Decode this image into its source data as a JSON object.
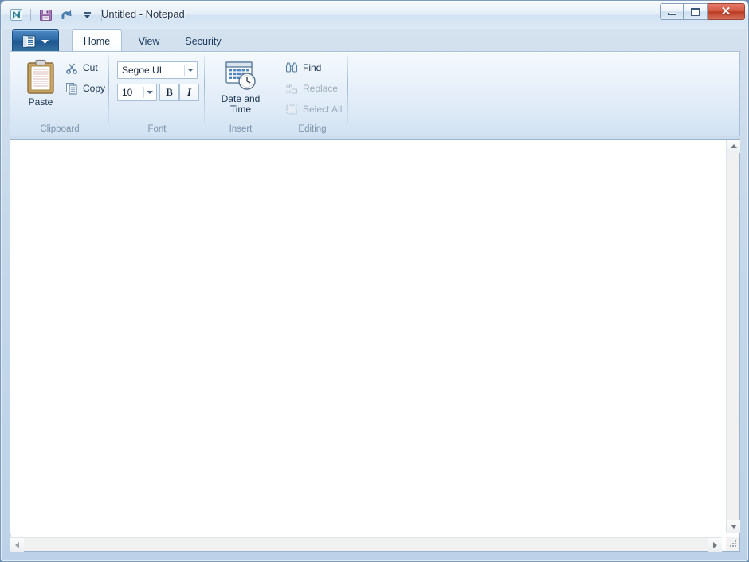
{
  "window": {
    "title": "Untitled - Notepad",
    "app_icon": "notepad-app-icon"
  },
  "quick_access_toolbar": {
    "items": [
      {
        "name": "save-button",
        "icon": "floppy-disk-icon",
        "label": "Save"
      },
      {
        "name": "undo-button",
        "icon": "undo-arrow-icon",
        "label": "Undo"
      },
      {
        "name": "customize-qat-button",
        "icon": "chevron-down-icon",
        "label": "Customize Quick Access Toolbar"
      }
    ]
  },
  "window_controls": {
    "minimize": "Minimize",
    "maximize": "Maximize",
    "close": "Close",
    "close_color": "#c0392b"
  },
  "ribbon": {
    "app_menu_label": "File",
    "tabs": [
      {
        "label": "Home",
        "active": true
      },
      {
        "label": "View",
        "active": false
      },
      {
        "label": "Security",
        "active": false
      }
    ],
    "groups": [
      {
        "label": "Clipboard",
        "big_buttons": [
          {
            "label": "Paste",
            "icon": "clipboard-icon",
            "enabled": true
          }
        ],
        "small_buttons": [
          {
            "label": "Cut",
            "icon": "scissors-icon",
            "enabled": true
          },
          {
            "label": "Copy",
            "icon": "copy-pages-icon",
            "enabled": true
          }
        ]
      },
      {
        "label": "Font",
        "font_family_value": "Segoe UI",
        "font_size_value": "10",
        "bold_label": "B",
        "italic_label": "I"
      },
      {
        "label": "Insert",
        "big_buttons": [
          {
            "label": "Date and Time",
            "line1": "Date and",
            "line2": "Time",
            "icon": "calendar-clock-icon",
            "enabled": true
          }
        ]
      },
      {
        "label": "Editing",
        "small_buttons": [
          {
            "label": "Find",
            "icon": "binoculars-icon",
            "enabled": true
          },
          {
            "label": "Replace",
            "icon": "replace-abac-icon",
            "enabled": false
          },
          {
            "label": "Select All",
            "icon": "select-all-dashed-box-icon",
            "enabled": false
          }
        ]
      }
    ]
  },
  "editor": {
    "value": "",
    "placeholder": ""
  },
  "scrollbars": {
    "vertical": {
      "up": "scroll-up",
      "down": "scroll-down"
    },
    "horizontal": {
      "left": "scroll-left",
      "right": "scroll-right"
    },
    "resize_grip": "resize-grip"
  },
  "colors": {
    "accent_blue": "#2f6ca8",
    "ribbon_bg": "#e6f0fa",
    "tab_active_bg": "#ffffff",
    "group_label": "#7d93ab",
    "disabled_text": "#9aabbd"
  }
}
